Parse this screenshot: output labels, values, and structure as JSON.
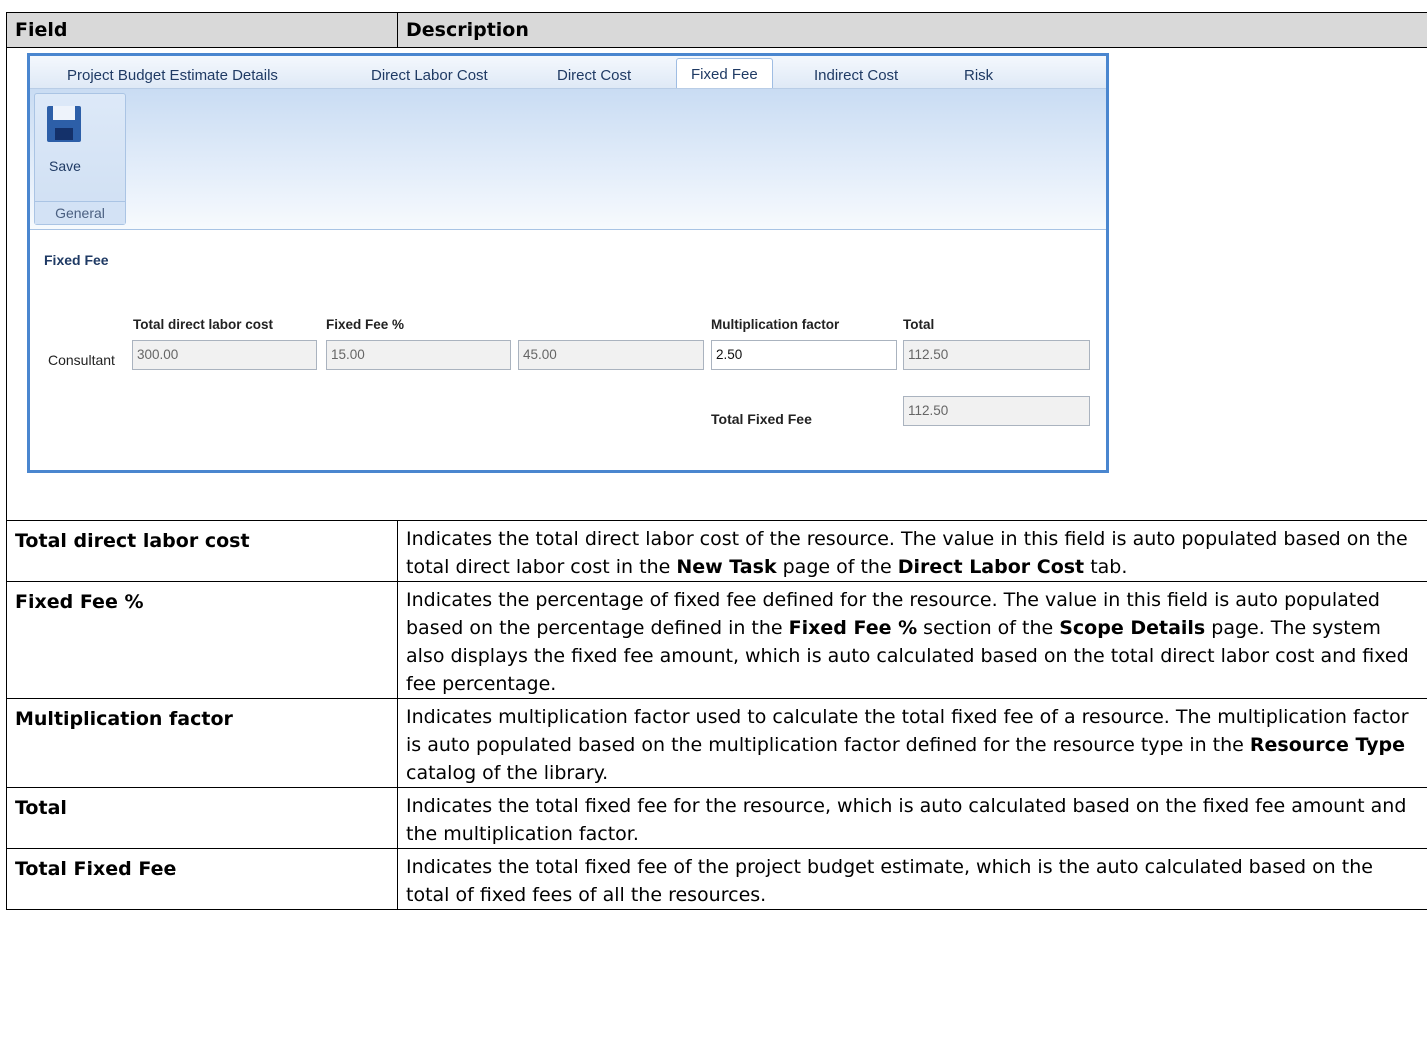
{
  "table": {
    "headers": {
      "field": "Field",
      "description": "Description"
    },
    "rows": [
      {
        "field": "Total direct labor cost",
        "html": "Indicates the total direct labor cost of the resource. The value in this field is  auto populated based on the total direct labor cost in the <b>New Task</b> page of the  <b>Direct Labor Cost</b> tab."
      },
      {
        "field": "Fixed Fee %",
        "html": "Indicates the percentage of fixed fee defined for the resource. The value in this field is auto populated based on the percentage defined in the <b>Fixed Fee %</b> section of the <b>Scope Details</b> page. The system also displays the fixed fee amount, which is auto calculated based  on the total direct labor cost and fixed fee percentage."
      },
      {
        "field": "Multiplication factor",
        "html": "Indicates multiplication factor used to calculate the total fixed fee of a resource. The multiplication factor is auto populated based on the multiplication factor defined for the resource type in the <b>Resource Type</b> catalog of the library."
      },
      {
        "field": "Total",
        "html": "Indicates the total fixed fee for the resource, which is auto calculated based  on the fixed fee amount and the multiplication factor."
      },
      {
        "field": "Total Fixed Fee",
        "html": "Indicates the total fixed fee of the project budget estimate, which is the auto calculated based on the total of fixed fees of all the resources."
      }
    ]
  },
  "app": {
    "tabs": [
      "Project Budget Estimate Details",
      "Direct Labor Cost",
      "Direct Cost",
      "Fixed Fee",
      "Indirect Cost",
      "Risk"
    ],
    "active_tab": "Fixed Fee",
    "ribbon": {
      "save_label": "Save",
      "group_label": "General"
    },
    "section_title": "Fixed Fee",
    "columns": {
      "total_direct_labor_cost": "Total direct labor cost",
      "fixed_fee_pct": "Fixed Fee %",
      "multiplication_factor": "Multiplication factor",
      "total": "Total"
    },
    "row": {
      "label": "Consultant",
      "total_direct_labor_cost": "300.00",
      "fixed_fee_pct": "15.00",
      "fixed_fee_amount": "45.00",
      "multiplication_factor": "2.50",
      "total": "112.50"
    },
    "total_fixed_fee": {
      "label": "Total Fixed Fee",
      "value": "112.50"
    }
  }
}
